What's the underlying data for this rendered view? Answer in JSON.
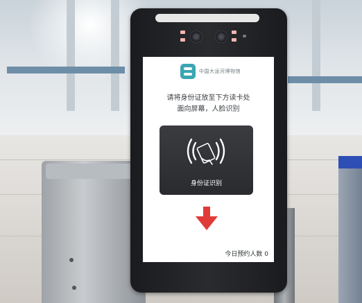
{
  "scene": {
    "description_colors": {
      "screen_bg": "#ffffff",
      "panel_bg": "#2f3033",
      "arrow": "#e03b38",
      "logo": "#3aa6b2"
    }
  },
  "device": {
    "screen": {
      "logo_text": "中国大运河博物馆",
      "instruction_line1": "请将身份证放至下方读卡处",
      "instruction_line2": "面向屏幕，人脸识别",
      "card_reader_label": "身份证识别",
      "footer_text": "今日预约人数 0"
    },
    "icons": [
      "nfc-icon",
      "down-arrow-icon",
      "camera-icon",
      "museum-logo-icon"
    ]
  }
}
